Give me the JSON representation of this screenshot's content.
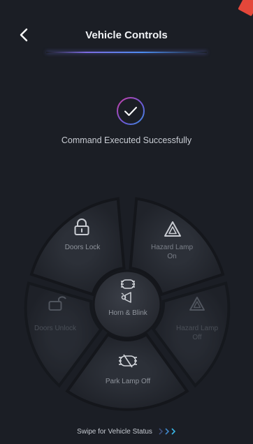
{
  "header": {
    "title": "Vehicle Controls"
  },
  "status": {
    "message": "Command Executed Successfully"
  },
  "controls": {
    "doors_lock": "Doors Lock",
    "hazard_on": "Hazard Lamp On",
    "doors_unlock": "Doors Unlock",
    "hazard_off": "Hazard Lamp Off",
    "park_lamp_off": "Park Lamp Off",
    "horn_blink": "Horn & Blink"
  },
  "footer": {
    "swipe_label": "Swipe for Vehicle Status"
  },
  "colors": {
    "background": "#1b1e25",
    "accent": "#7c6be0",
    "accent2": "#4c8df0"
  }
}
